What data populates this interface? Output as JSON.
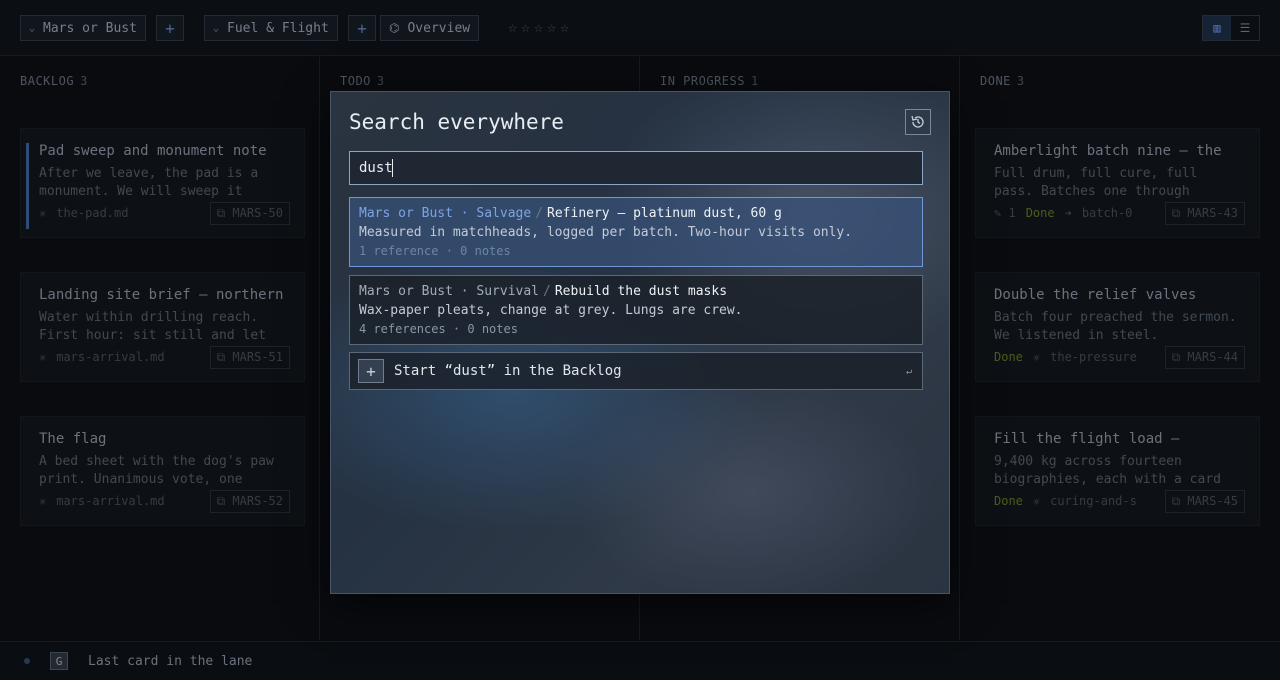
{
  "topbar": {
    "board1": "Mars or Bust",
    "board2": "Fuel & Flight",
    "overview": "Overview",
    "stars": [
      "☆",
      "☆",
      "☆",
      "☆",
      "☆"
    ]
  },
  "columns": [
    {
      "title": "BACKLOG",
      "count": "3"
    },
    {
      "title": "TODO",
      "count": "3"
    },
    {
      "title": "IN PROGRESS",
      "count": "1"
    },
    {
      "title": "DONE",
      "count": "3"
    }
  ],
  "backlog_cards": [
    {
      "title": "Pad sweep and monument note",
      "body": "After we leave, the pad is a monument. We will sweep it",
      "file": "the-pad.md",
      "id": "MARS-50"
    },
    {
      "title": "Landing site brief — northern",
      "body": "Water within drilling reach. First hour: sit still and let",
      "file": "mars-arrival.md",
      "id": "MARS-51"
    },
    {
      "title": "The flag",
      "body": "A bed sheet with the dog's paw print. Unanimous vote, one",
      "file": "mars-arrival.md",
      "id": "MARS-52"
    }
  ],
  "done_cards": [
    {
      "title": "Amberlight batch nine — the",
      "body": "Full drum, full cure, full pass. Batches one through",
      "comments": "1",
      "status": "Done",
      "file": "batch-0",
      "id": "MARS-43"
    },
    {
      "title": "Double the relief valves",
      "body": "Batch four preached the sermon. We listened in steel.",
      "status": "Done",
      "file": "the-pressure",
      "id": "MARS-44"
    },
    {
      "title": "Fill the flight load —",
      "body": "9,400 kg across fourteen biographies, each with a card",
      "status": "Done",
      "file": "curing-and-s",
      "id": "MARS-45"
    }
  ],
  "bottombar": {
    "key": "G",
    "text": "Last card in the lane"
  },
  "modal": {
    "title": "Search everywhere",
    "query": "dust",
    "results": [
      {
        "path": "Mars or Bust · Salvage",
        "sep": "/",
        "title": "Refinery — platinum dust, 60 g",
        "desc": "Measured in matchheads, logged per batch. Two-hour visits only.",
        "meta": "1 reference · 0 notes"
      },
      {
        "path": "Mars or Bust · Survival",
        "sep": "/",
        "title": "Rebuild the dust masks",
        "desc": "Wax-paper pleats, change at grey. Lungs are crew.",
        "meta": "4 references · 0 notes"
      }
    ],
    "create_label": "Start “dust” in the Backlog"
  },
  "colors": {
    "accent": "#6f97d8",
    "done": "#5d6b22",
    "background": "#0b0e12"
  }
}
